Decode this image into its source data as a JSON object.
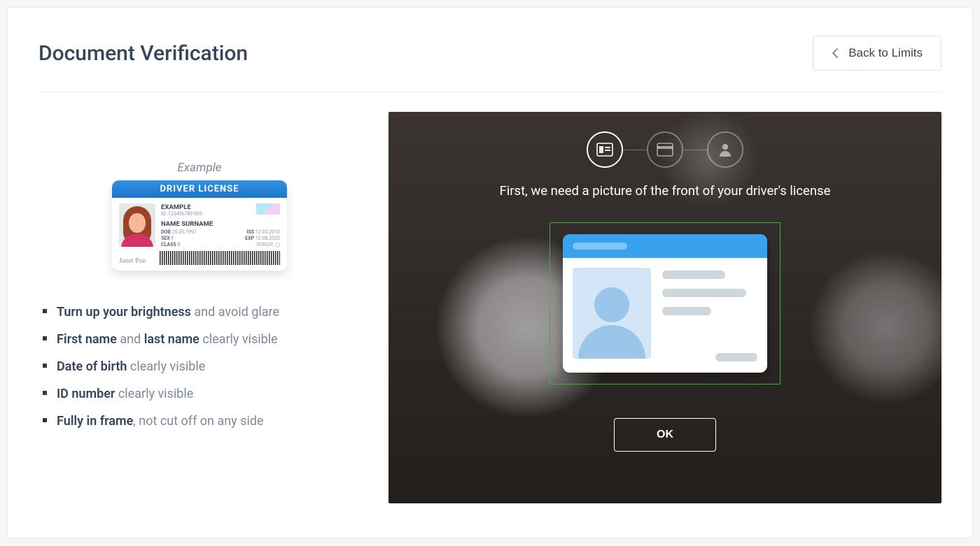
{
  "header": {
    "title": "Document Verification",
    "back_label": "Back to Limits"
  },
  "example": {
    "label": "Example",
    "license": {
      "title": "DRIVER LICENSE",
      "example_text": "EXAMPLE",
      "id_line": "ID: 123456789-005",
      "name_line": "NAME SURNAME",
      "dob_label": "DOB",
      "dob": "25.05.1997",
      "iss_label": "ISS",
      "iss": "12.03.2012",
      "sex_label": "SEX",
      "sex": "F",
      "exp_label": "EXP",
      "exp": "12.08.2020",
      "class_label": "CLASS",
      "class": "B",
      "donor_label": "DONOR",
      "signature": "Janet Poe"
    }
  },
  "tips": [
    {
      "bold1": "Turn up your brightness",
      "rest1": " and avoid glare"
    },
    {
      "bold1": "First name",
      "rest1": " and ",
      "bold2": "last name",
      "rest2": " clearly visible"
    },
    {
      "bold1": "Date of birth",
      "rest1": " clearly visible"
    },
    {
      "bold1": "ID number",
      "rest1": " clearly visible"
    },
    {
      "bold1": "Fully in frame",
      "rest1": ", not cut off on any side"
    }
  ],
  "verify": {
    "instruction": "First, we need a picture of the front of your driver's license",
    "ok_label": "OK"
  }
}
